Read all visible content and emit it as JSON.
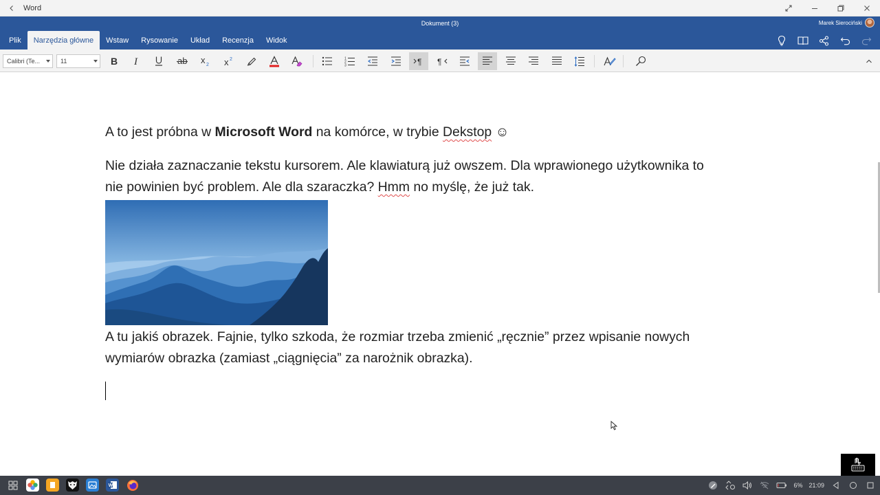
{
  "window": {
    "app_name": "Word"
  },
  "header": {
    "document_title": "Dokument (3)",
    "user_name": "Marek Sierociński",
    "tabs": [
      {
        "label": "Plik",
        "active": false
      },
      {
        "label": "Narzędzia główne",
        "active": true
      },
      {
        "label": "Wstaw",
        "active": false
      },
      {
        "label": "Rysowanie",
        "active": false
      },
      {
        "label": "Układ",
        "active": false
      },
      {
        "label": "Recenzja",
        "active": false
      },
      {
        "label": "Widok",
        "active": false
      }
    ],
    "right_icons": [
      "lightbulb-icon",
      "reading-view-icon",
      "share-icon",
      "undo-icon",
      "redo-icon"
    ]
  },
  "ribbon": {
    "font_name": "Calibri (Te...",
    "font_size": "11",
    "buttons": [
      "bold",
      "italic",
      "underline",
      "strikethrough",
      "subscript",
      "superscript",
      "highlight",
      "font-color",
      "clear-formatting",
      "bullets",
      "numbering",
      "decrease-indent",
      "increase-indent",
      "ltr-paragraph",
      "rtl-paragraph",
      "rtl-indent",
      "align-left",
      "align-center",
      "align-right",
      "justify",
      "line-spacing",
      "styles",
      "find"
    ],
    "selected": [
      "ltr-paragraph",
      "align-left"
    ],
    "font_color_accent": "#e02020"
  },
  "document": {
    "paragraph1": {
      "before": "A to jest próbna w ",
      "bold": "Microsoft Word",
      "middle": " na komórce, w trybie ",
      "misspelled": "Dekstop",
      "after": " ☺"
    },
    "paragraph2": {
      "line1": "Nie działa zaznaczanie tekstu kursorem. Ale klawiaturą już owszem. Dla wprawionego użytkownika to",
      "line2_before": "nie powinien być problem. Ale dla szaraczka? ",
      "line2_misspelled": "Hmm",
      "line2_after": " no myślę, że już tak."
    },
    "image_alt": "mountain landscape",
    "paragraph3": {
      "line1": "A tu jakiś obrazek. Fajnie, tylko szkoda, że rozmiar trzeba zmienić „ręcznie” przez wpisanie nowych",
      "line2": "wymiarów obrazka (zamiast „ciągnięcia” za narożnik obrazka)."
    }
  },
  "taskbar": {
    "apps": [
      "grid-menu-icon",
      "photos-icon",
      "files-icon",
      "browser-icon",
      "gallery-icon",
      "word-icon",
      "firefox-icon"
    ],
    "battery": "6%",
    "time": "21:09"
  },
  "colors": {
    "word_blue": "#2b579a",
    "ribbon_bg": "#f3f3f3",
    "taskbar_bg": "#3c4048"
  }
}
